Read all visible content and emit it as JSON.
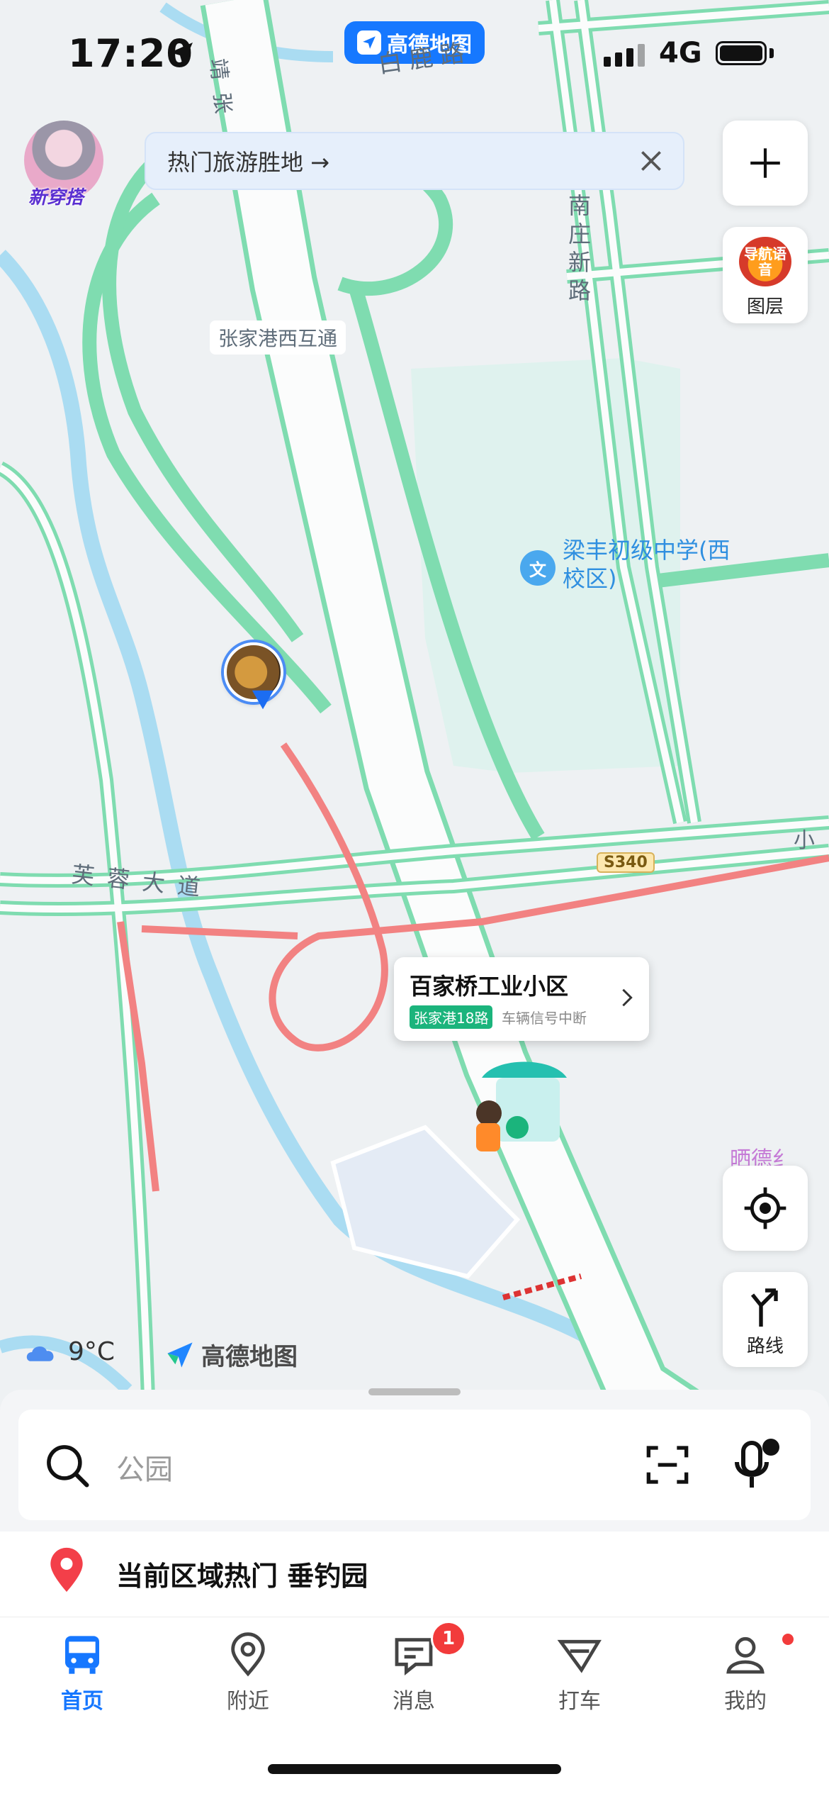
{
  "status_bar": {
    "time": "17:20",
    "app_name": "高德地图",
    "network": "4G"
  },
  "avatar": {
    "tag": "新穿搭"
  },
  "promo": {
    "text": "热门旅游胜地 →"
  },
  "right_tools": {
    "plus": "+",
    "layer_icon_text": "导航语音",
    "layer_label": "图层",
    "route_label": "路线"
  },
  "map": {
    "labels": {
      "top_road": "白鹿路",
      "jing_zhang": "靖张",
      "nan_zhuang": "南庄新路",
      "interchange": "张家港西互通",
      "school": "梁丰初级中学(西校区)",
      "school_pin": "文",
      "road_code": "S340",
      "furong": "芙蓉大道",
      "xiao": "小",
      "right_poi": "晒德纟"
    },
    "colors": {
      "road_green": "#7fdcb0",
      "road_red": "#f28282",
      "water": "#aadcf2",
      "land": "#eef1f3"
    }
  },
  "bus_stop": {
    "title": "百家桥工业小区",
    "line": "张家港18路",
    "status": "车辆信号中断"
  },
  "weather": {
    "icon": "cloud-icon",
    "temp": "9°C"
  },
  "logo": {
    "text": "高德地图"
  },
  "search": {
    "placeholder": "公园"
  },
  "hot": {
    "text": "当前区域热门 垂钓园"
  },
  "tabs": [
    {
      "label": "首页",
      "icon": "bus-icon",
      "active": true
    },
    {
      "label": "附近",
      "icon": "location-pin-icon"
    },
    {
      "label": "消息",
      "icon": "message-icon",
      "badge": "1"
    },
    {
      "label": "打车",
      "icon": "taxi-icon"
    },
    {
      "label": "我的",
      "icon": "profile-icon"
    }
  ]
}
